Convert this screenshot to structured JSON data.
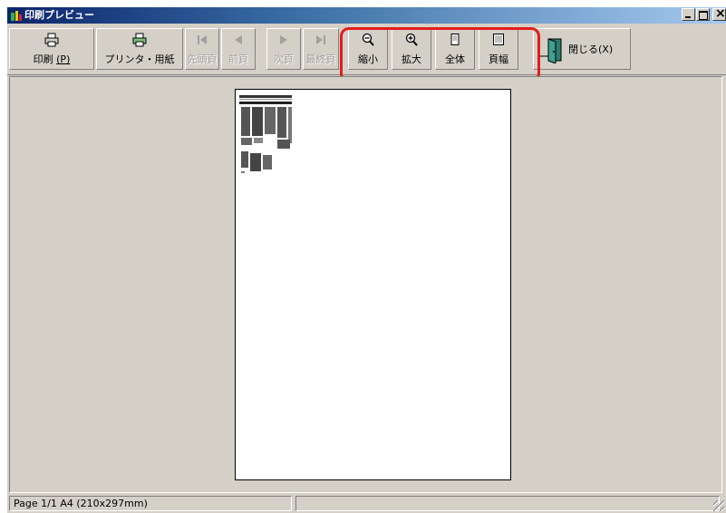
{
  "window": {
    "title": "印刷プレビュー"
  },
  "toolbar": {
    "print_label": "印刷",
    "print_mnemonic": "(P)",
    "printer_label": "プリンタ・用紙",
    "first_label": "先頭頁",
    "prev_label": "前頁",
    "next_label": "次頁",
    "last_label": "最終頁",
    "zoom_out_label": "縮小",
    "zoom_in_label": "拡大",
    "whole_label": "全体",
    "width_label": "頁幅",
    "close_label": "閉じる(X)"
  },
  "status": {
    "page_info": "Page  1/1  A4 (210x297mm)"
  },
  "colors": {
    "highlight": "#e51c1c",
    "titlebar_start": "#0a246a",
    "titlebar_end": "#a6caf0"
  },
  "icons": [
    "app-icon",
    "printer-icon",
    "printer-paper-icon",
    "first-page-icon",
    "prev-page-icon",
    "next-page-icon",
    "last-page-icon",
    "zoom-out-icon",
    "zoom-in-icon",
    "whole-page-icon",
    "page-width-icon",
    "exit-door-icon"
  ]
}
